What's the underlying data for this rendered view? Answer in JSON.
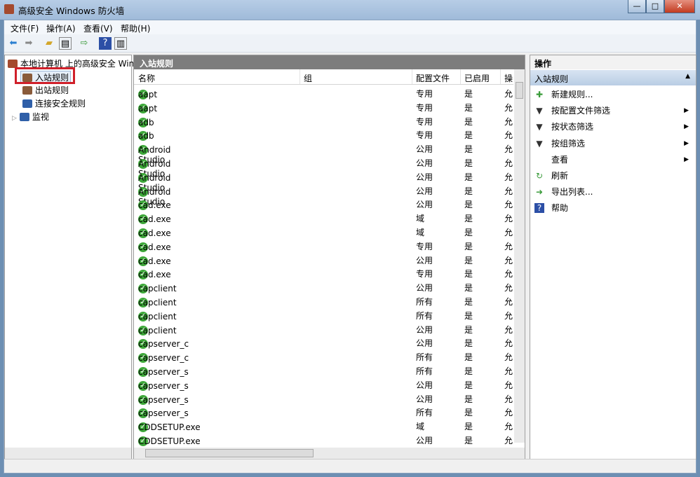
{
  "window": {
    "title": "高级安全 Windows 防火墙",
    "min": "—",
    "max": "□",
    "close": "✕"
  },
  "menu": [
    "文件(F)",
    "操作(A)",
    "查看(V)",
    "帮助(H)"
  ],
  "tree": {
    "root": "本地计算机 上的高级安全 Wind",
    "items": [
      "入站规则",
      "出站规则",
      "连接安全规则",
      "监视"
    ]
  },
  "list": {
    "header": "入站规则",
    "columns": [
      "名称",
      "组",
      "配置文件",
      "已启用",
      "操"
    ],
    "rows": [
      [
        "aapt",
        "",
        "专用",
        "是",
        "允"
      ],
      [
        "aapt",
        "",
        "专用",
        "是",
        "允"
      ],
      [
        "adb",
        "",
        "专用",
        "是",
        "允"
      ],
      [
        "adb",
        "",
        "专用",
        "是",
        "允"
      ],
      [
        "Android Studio",
        "",
        "公用",
        "是",
        "允"
      ],
      [
        "Android Studio",
        "",
        "公用",
        "是",
        "允"
      ],
      [
        "Android Studio",
        "",
        "公用",
        "是",
        "允"
      ],
      [
        "Android Studio",
        "",
        "公用",
        "是",
        "允"
      ],
      [
        "cad.exe",
        "",
        "公用",
        "是",
        "允"
      ],
      [
        "cad.exe",
        "",
        "域",
        "是",
        "允"
      ],
      [
        "cad.exe",
        "",
        "域",
        "是",
        "允"
      ],
      [
        "cad.exe",
        "",
        "专用",
        "是",
        "允"
      ],
      [
        "cad.exe",
        "",
        "公用",
        "是",
        "允"
      ],
      [
        "cad.exe",
        "",
        "专用",
        "是",
        "允"
      ],
      [
        "capclient",
        "",
        "公用",
        "是",
        "允"
      ],
      [
        "capclient",
        "",
        "所有",
        "是",
        "允"
      ],
      [
        "capclient",
        "",
        "所有",
        "是",
        "允"
      ],
      [
        "capclient",
        "",
        "公用",
        "是",
        "允"
      ],
      [
        "capserver_c",
        "",
        "公用",
        "是",
        "允"
      ],
      [
        "capserver_c",
        "",
        "所有",
        "是",
        "允"
      ],
      [
        "capserver_s",
        "",
        "所有",
        "是",
        "允"
      ],
      [
        "capserver_s",
        "",
        "公用",
        "是",
        "允"
      ],
      [
        "capserver_s",
        "",
        "公用",
        "是",
        "允"
      ],
      [
        "capserver_s",
        "",
        "所有",
        "是",
        "允"
      ],
      [
        "CDDSETUP.exe",
        "",
        "域",
        "是",
        "允"
      ],
      [
        "CDDSETUP.exe",
        "",
        "公用",
        "是",
        "允"
      ]
    ]
  },
  "actions": {
    "header": "操作",
    "section": "入站规则",
    "items": [
      {
        "label": "新建规则...",
        "icon": "new-rule-icon",
        "sym": "✚",
        "arrow": false
      },
      {
        "label": "按配置文件筛选",
        "icon": "filter-icon",
        "sym": "▼",
        "arrow": true
      },
      {
        "label": "按状态筛选",
        "icon": "filter-icon",
        "sym": "▼",
        "arrow": true
      },
      {
        "label": "按组筛选",
        "icon": "filter-icon",
        "sym": "▼",
        "arrow": true
      },
      {
        "label": "查看",
        "icon": "",
        "sym": "",
        "arrow": true
      },
      {
        "label": "刷新",
        "icon": "refresh-icon",
        "sym": "↻",
        "arrow": false
      },
      {
        "label": "导出列表...",
        "icon": "export-icon",
        "sym": "➜",
        "arrow": false
      },
      {
        "label": "帮助",
        "icon": "help-icon",
        "sym": "?",
        "arrow": false
      }
    ]
  }
}
